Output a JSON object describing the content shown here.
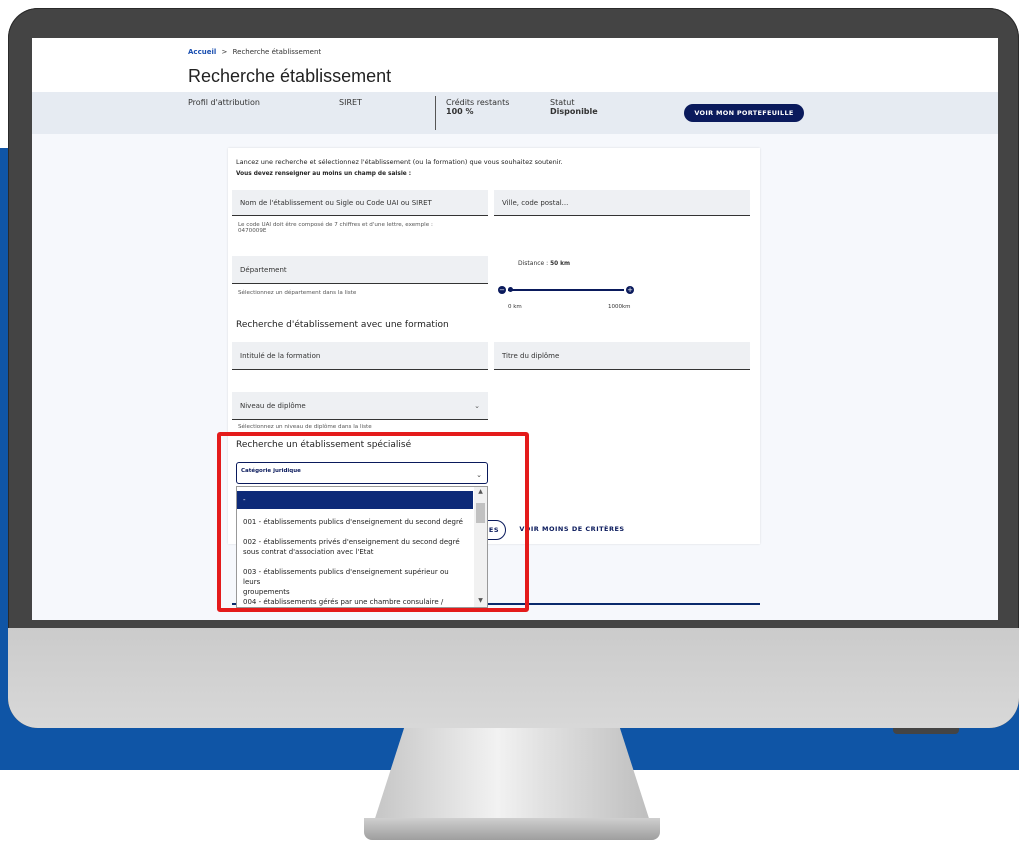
{
  "breadcrumb": {
    "home": "Accueil",
    "separator": ">",
    "current": "Recherche établissement"
  },
  "page_title": "Recherche établissement",
  "info_bar": {
    "profil_label": "Profil d'attribution",
    "siret_label": "SIRET",
    "credits_label": "Crédits restants",
    "credits_value": "100 %",
    "statut_label": "Statut",
    "statut_value": "Disponible",
    "wallet_button": "VOIR MON PORTEFEUILLE"
  },
  "form": {
    "intro": "Lancez une recherche et sélectionnez l'établissement (ou la formation) que vous souhaitez soutenir.",
    "required_note": "Vous devez renseigner au moins un champ de saisie :",
    "name_field": "Nom de l'établissement ou Sigle ou Code UAI ou SIRET",
    "name_help": "Le code UAI doit être composé de 7 chiffres et d'une lettre, exemple :",
    "name_help_example": "0470009E",
    "city_field": "Ville, code postal...",
    "departement_field": "Département",
    "departement_help": "Sélectionnez un département dans la liste",
    "distance_label": "Distance :",
    "distance_value": "50 km",
    "distance_min": "0 km",
    "distance_max": "1000km",
    "formation_section": "Recherche d'établissement avec une formation",
    "formation_field": "Intitulé de la formation",
    "diplome_title_field": "Titre du diplôme",
    "niveau_field": "Niveau de diplôme",
    "niveau_help": "Sélectionnez un niveau de diplôme dans la liste",
    "specialise_section": "Recherche un établissement spécialisé",
    "categorie_label": "Catégorie juridique",
    "btn_partial": "ES",
    "btn_less": "VOIR MOINS DE CRITÈRES"
  },
  "dropdown": {
    "selected": "-",
    "options": [
      "001 - établissements publics d'enseignement du second degré",
      "002 - établissements privés d'enseignement du second degré",
      "sous contrat d'association avec l'Etat",
      "003 - établissements publics d'enseignement supérieur ou leurs",
      "groupements",
      "004 - établissements gérés par une chambre consulaire /"
    ]
  },
  "colors": {
    "navy": "#0a1a5c",
    "highlight": "#e41b1b",
    "background_blue": "#0f55a6"
  }
}
